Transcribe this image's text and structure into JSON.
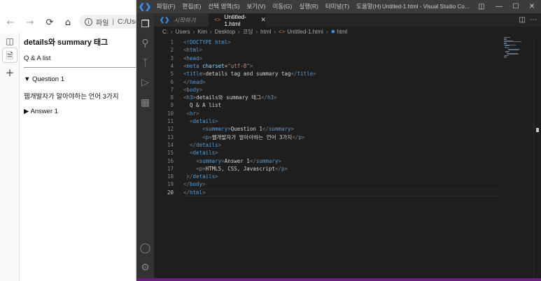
{
  "browser": {
    "address": {
      "label": "파일",
      "url": "C:/Use"
    },
    "page": {
      "heading": "details와 summary 태그",
      "list_text": "Q & A list",
      "details": [
        {
          "summary": "Question 1",
          "open": true,
          "paragraph": "웹개발자가 알아야하는 언어 3가지"
        },
        {
          "summary": "Answer 1",
          "open": false
        }
      ]
    }
  },
  "vscode": {
    "menu": [
      "파일(F)",
      "편집(E)",
      "선택 영역(S)",
      "보기(V)",
      "이동(G)",
      "실행(R)",
      "터미널(T)",
      "도움말(H)"
    ],
    "window_title": "Untitled-1.html - Visual Studio Co...",
    "tabs": [
      {
        "label": "시작하기",
        "active": false
      },
      {
        "label": "Untitled-1.html",
        "active": true
      }
    ],
    "breadcrumb": [
      "C:",
      "Users",
      "Kim",
      "Desktop",
      "코딩",
      "html",
      "Untitled-1.html",
      "html"
    ],
    "current_line": 20,
    "code_lines": [
      "<!DOCTYPE html>",
      "<html>",
      "<head>",
      "<meta charset=\"utf-8\">",
      "<title>details tag and summary tag</title>",
      "</head>",
      "<body>",
      "<h3>details와 summary 태그</h3>",
      "  Q & A list",
      " <hr>",
      "  <details>",
      "      <summary>Question 1</summary>",
      "      <p>웹개발자가 알아야하는 언어 3가지</p>",
      "  </details>",
      "  <details>",
      "    <summary>Answer 1</summary>",
      "    <p>HTML5, CSS, Javascript</p>",
      " </details>",
      "</body>",
      "</html>"
    ]
  }
}
